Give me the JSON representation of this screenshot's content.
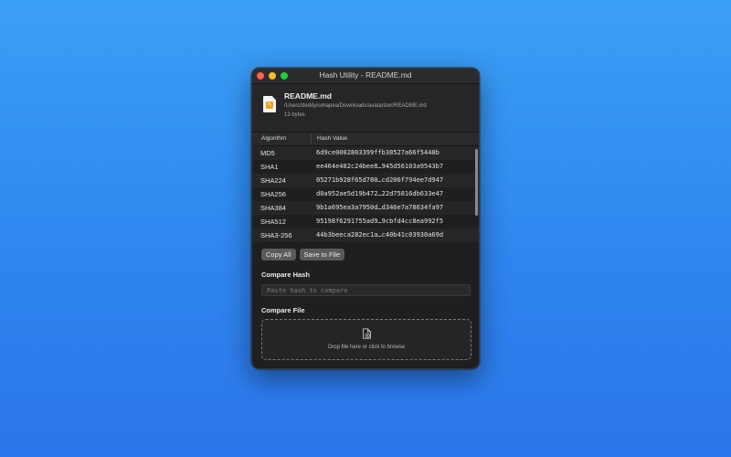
{
  "window": {
    "title": "Hash Utility - README.md"
  },
  "file": {
    "name": "README.md",
    "path": "/Users/deddyrumapea/Downloads/avatarizer/README.md",
    "size": "13 bytes"
  },
  "table": {
    "headers": {
      "algorithm": "Algorithm",
      "hash": "Hash Value"
    },
    "rows": [
      {
        "algorithm": "MD5",
        "hash": "6d9ce0002803399ffb38527a66f5448b"
      },
      {
        "algorithm": "SHA1",
        "hash": "ee464e482c24bee8…945d56103a9543b7"
      },
      {
        "algorithm": "SHA224",
        "hash": "05271b928f65d780…cd206f794ee7d947"
      },
      {
        "algorithm": "SHA256",
        "hash": "d0a952ae5d19b472…22d75816db633e47"
      },
      {
        "algorithm": "SHA384",
        "hash": "9b1a695ea3a7950d…d346e7a78634fa97"
      },
      {
        "algorithm": "SHA512",
        "hash": "95198f6291755ad9…9cbfd4cc8ea992f5"
      },
      {
        "algorithm": "SHA3-256",
        "hash": "44b3beeca282ec1a…c40b41c03930a69d"
      }
    ]
  },
  "buttons": {
    "copy_all": "Copy All",
    "save_to_file": "Save to File"
  },
  "compare_hash": {
    "label": "Compare Hash",
    "placeholder": "Paste hash to compare"
  },
  "compare_file": {
    "label": "Compare File",
    "drop_text": "Drop file here or click to browse"
  },
  "colors": {
    "close": "#fe5f57",
    "minimize": "#febc2e",
    "maximize": "#28c840",
    "file_icon_accent": "#f0a020"
  },
  "icons": {
    "file": "document-icon",
    "drop": "file-add-icon"
  }
}
